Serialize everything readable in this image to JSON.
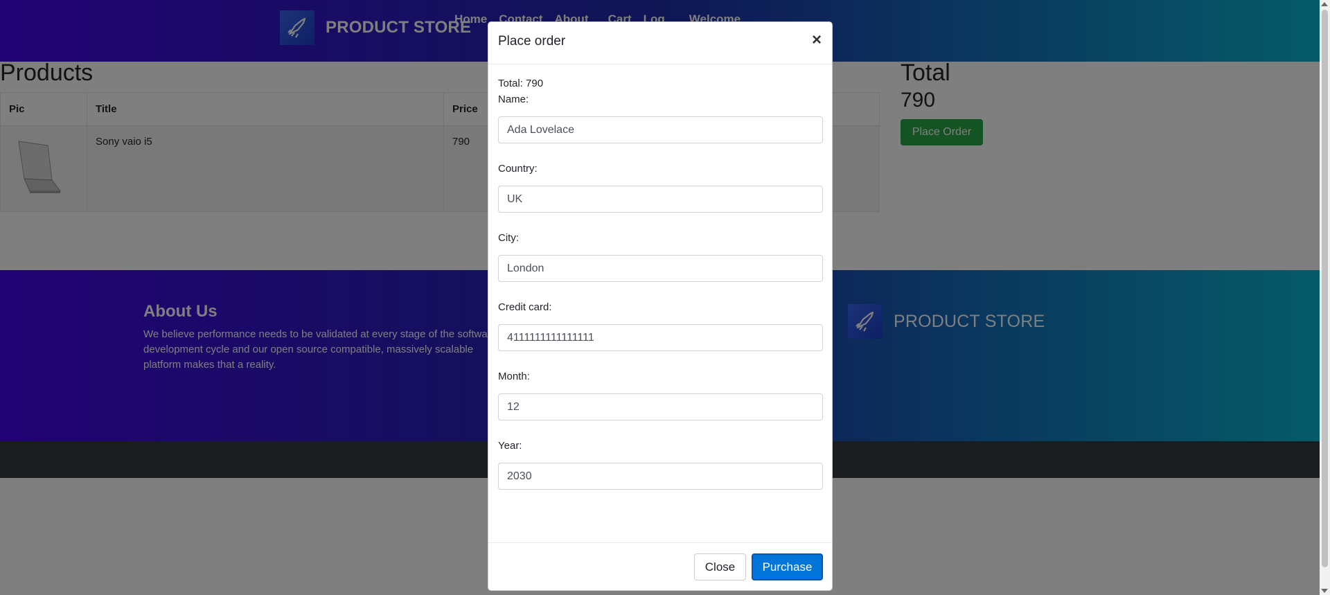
{
  "header": {
    "brand": "PRODUCT STORE",
    "nav": [
      "Home",
      "Contact",
      "About",
      "Cart",
      "Log",
      "Welcome"
    ]
  },
  "products": {
    "title": "Products",
    "columns": [
      "Pic",
      "Title",
      "Price"
    ],
    "rows": [
      {
        "title": "Sony vaio i5",
        "price": "790"
      }
    ]
  },
  "cart_total": {
    "title": "Total",
    "value": "790",
    "place_order_label": "Place Order"
  },
  "footer": {
    "about_title": "About Us",
    "about_text": "We believe performance needs to be validated at every stage of the software development cycle and our open source compatible, massively scalable platform makes that a reality.",
    "brand": "PRODUCT STORE"
  },
  "modal": {
    "title": "Place order",
    "close_x": "×",
    "total_line": "Total: 790",
    "fields": [
      {
        "label": "Name:",
        "value": "Ada Lovelace"
      },
      {
        "label": "Country:",
        "value": "UK"
      },
      {
        "label": "City:",
        "value": "London"
      },
      {
        "label": "Credit card:",
        "value": "4111111111111111"
      },
      {
        "label": "Month:",
        "value": "12"
      },
      {
        "label": "Year:",
        "value": "2030"
      }
    ],
    "close_label": "Close",
    "purchase_label": "Purchase"
  },
  "colors": {
    "header_gradient_start": "#4204e6",
    "header_gradient_end": "#0bb7cf",
    "place_order_green": "#28a745",
    "purchase_blue": "#0275d8"
  },
  "icons": {
    "brand_logo": "rocket-logo-icon",
    "modal_close": "close-icon"
  }
}
